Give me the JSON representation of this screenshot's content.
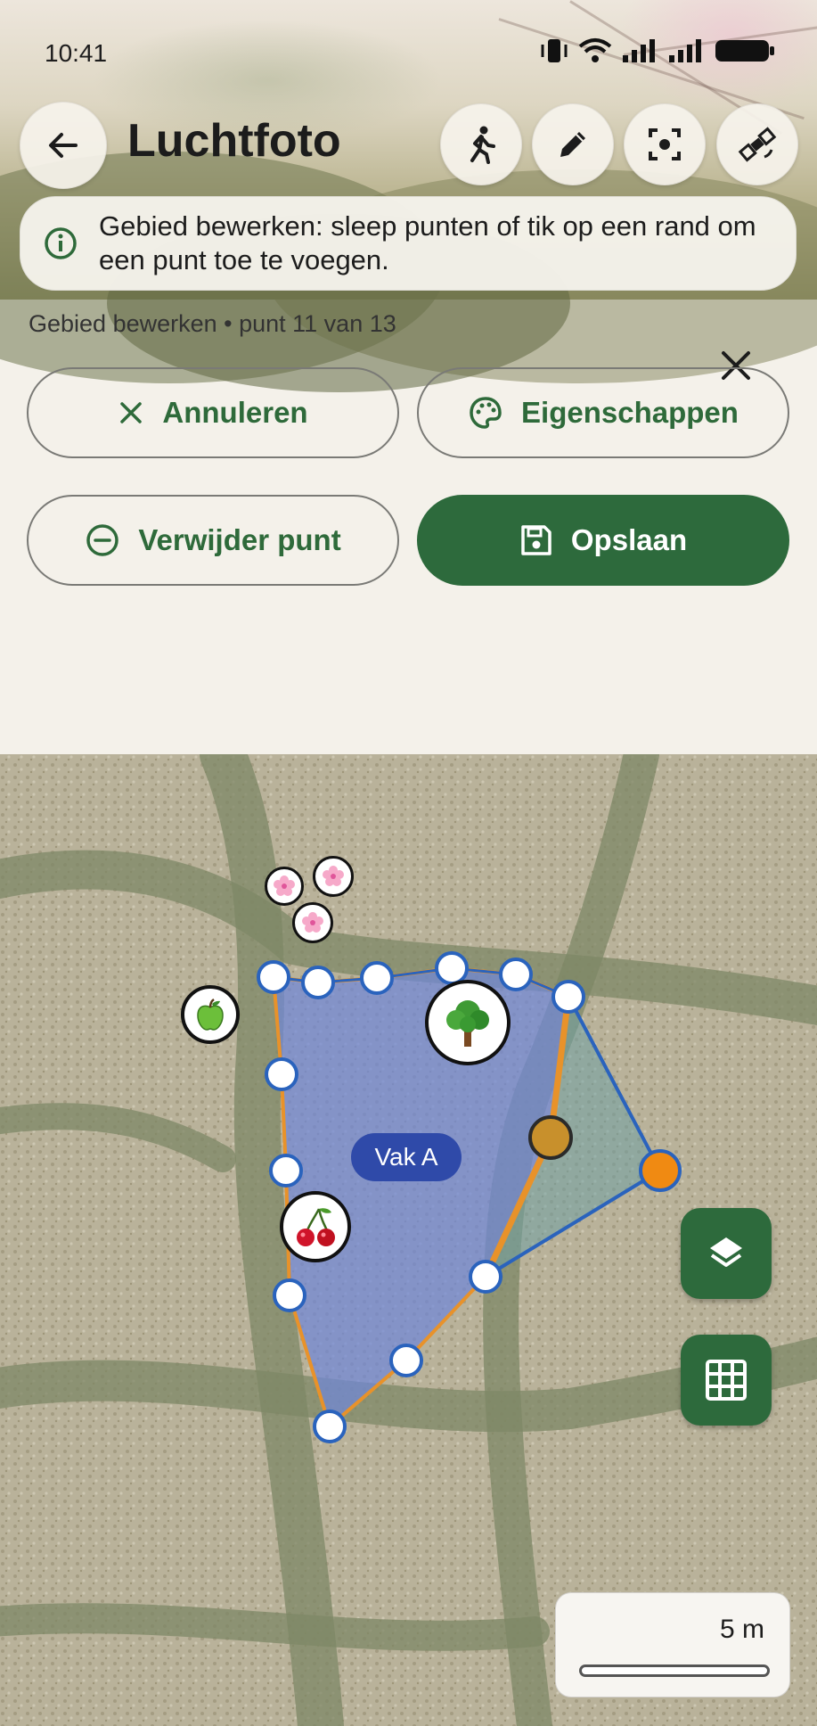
{
  "status_bar": {
    "time": "10:41"
  },
  "header": {
    "title": "Luchtfoto",
    "back_icon": "arrow-left-icon",
    "actions": [
      {
        "name": "walk-icon"
      },
      {
        "name": "pencil-icon"
      },
      {
        "name": "focus-icon"
      },
      {
        "name": "satellite-icon"
      }
    ]
  },
  "info_banner": {
    "text": "Gebied bewerken: sleep punten of tik op een rand om een punt toe te voegen."
  },
  "edit_panel": {
    "status": "Gebied bewerken • punt 11 van 13",
    "cancel_label": "Annuleren",
    "properties_label": "Eigenschappen",
    "delete_point_label": "Verwijder punt",
    "save_label": "Opslaan"
  },
  "map": {
    "area_label": "Vak A",
    "scale_label": "5 m",
    "markers": [
      "blossom-icon",
      "blossom-icon",
      "blossom-icon",
      "apple-icon",
      "tree-icon",
      "cherry-icon"
    ],
    "colors": {
      "area_fill": "#6f86d8",
      "area_stroke": "#2a63bd",
      "edge_highlight": "#e8922a",
      "selected_point": "#f08a12",
      "button": "#2d6a3c"
    }
  }
}
